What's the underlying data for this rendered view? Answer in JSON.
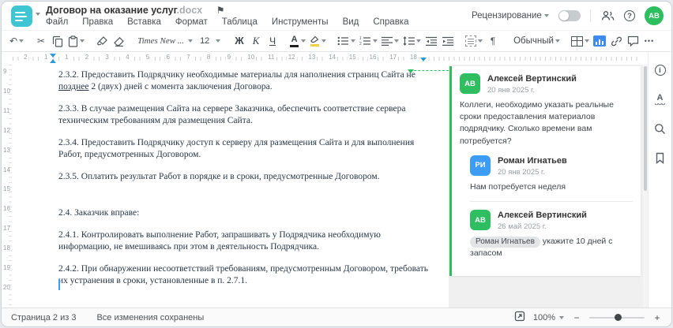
{
  "header": {
    "title": "Договор на оказание услуг",
    "title_ext": ".docx",
    "menu": [
      "Файл",
      "Правка",
      "Вставка",
      "Формат",
      "Таблица",
      "Инструменты",
      "Вид",
      "Справка"
    ],
    "review_label": "Рецензирование",
    "avatar_initials": "АВ"
  },
  "toolbar": {
    "font_name": "Times New ...",
    "font_size": "12",
    "bold_glyph": "Ж",
    "italic_glyph": "К",
    "underline_glyph": "Ч",
    "font_color_glyph": "А",
    "style_name": "Обычный"
  },
  "icons": {
    "flag": "⚑",
    "undo": "↶",
    "cut": "✂",
    "pilcrow": "¶",
    "more": "•••",
    "help": "?",
    "info": "i",
    "spell_letter": "А",
    "minus": "−",
    "plus": "+"
  },
  "ruler": {
    "h_pre_numbers": [
      "2",
      "1"
    ],
    "h_numbers": [
      "1",
      "2",
      "3",
      "4",
      "5",
      "6",
      "7",
      "8",
      "9",
      "10",
      "11",
      "12",
      "13",
      "14",
      "15",
      "16",
      "17",
      "18"
    ],
    "v_numbers": [
      "9",
      "10",
      "11",
      "12",
      "13",
      "14",
      "15",
      "16",
      "17",
      "18",
      "19",
      "20"
    ]
  },
  "document": {
    "paragraphs": [
      {
        "before": "2.3.2. Предоставить Подрядчику необходимые материалы для наполнения страниц Сайта не ",
        "underline": "позднее",
        "after": " 2 (двух) дней с момента заключения Договора."
      },
      {
        "text": "2.3.3. В случае размещения Сайта на сервере Заказчика, обеспечить соответствие сервера техническим требованиям для размещения Сайта."
      },
      {
        "text": "2.3.4. Предоставить Подрядчику доступ к серверу для размещения Сайта и для выполнения Работ, предусмотренных Договором."
      },
      {
        "text": "2.3.5. Оплатить результат Работ в порядке и в сроки, предусмотренные Договором."
      },
      {
        "text": "2.4. Заказчик вправе:",
        "gap": true
      },
      {
        "text": "2.4.1. Контролировать выполнение Работ, запрашивать у Подрядчика необходимую информацию, не вмешиваясь при этом в деятельность Подрядчика."
      },
      {
        "text": "2.4.2. При обнаружении несоответствий требованиям, предусмотренным Договором, требовать их устранения в сроки, установленные в п. 2.7.1."
      }
    ]
  },
  "comments": {
    "thread": [
      {
        "initials": "АВ",
        "name": "Алексей Вертинский",
        "date": "20 янв 2025 г.",
        "text": "Коллеги, необходимо указать реальные сроки предоставления материалов подрядчику. Сколько времени вам потребуется?",
        "color": "#2ebd5f",
        "reply": false
      },
      {
        "initials": "РИ",
        "name": "Роман Игнатьев",
        "date": "20 янв 2025 г.",
        "text": "Нам потребуется неделя",
        "color": "#3d9df6",
        "reply": true
      },
      {
        "initials": "АВ",
        "name": "Алексей Вертинский",
        "date": "26 май 2025 г.",
        "mention": "Роман Игнатьев",
        "text": "укажите 10 дней с запасом",
        "color": "#2ebd5f",
        "reply": true,
        "divider_before": true
      }
    ]
  },
  "statusbar": {
    "page_info": "Страница 2 из 3",
    "save_status": "Все изменения сохранены",
    "zoom_value": "100%"
  },
  "colors": {
    "brand_teal": "#3fc6d2",
    "accent_green": "#2ebd5f",
    "accent_blue": "#3d9df6",
    "ruler_marker_blue": "#2f9bd6",
    "image_icon_blue": "#3d8af0",
    "highlighter_yellow": "#f3cf45",
    "font_color_black": "#1f1f1f"
  }
}
